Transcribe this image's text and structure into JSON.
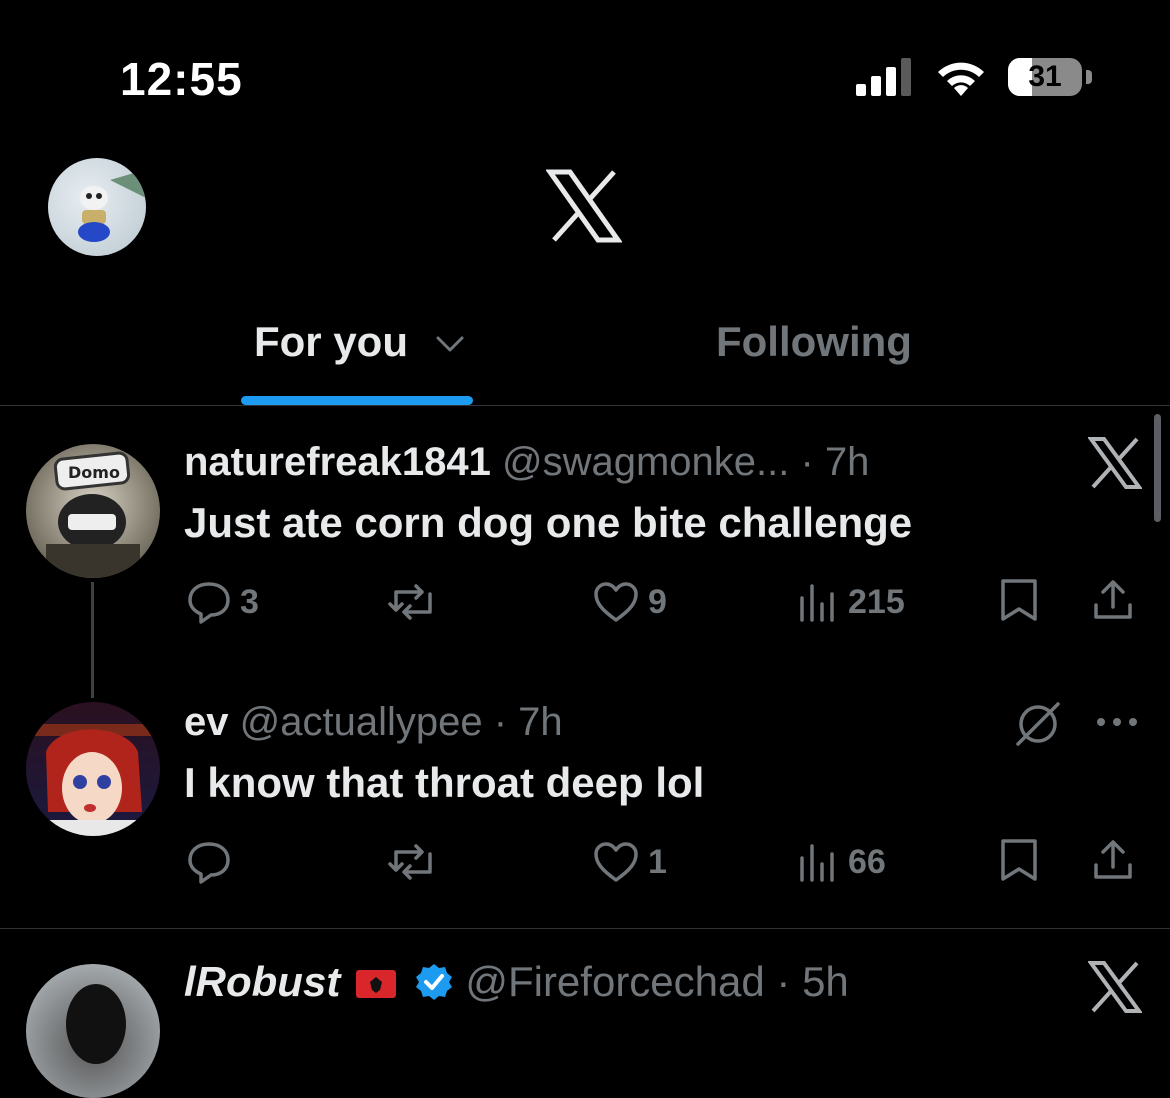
{
  "status_bar": {
    "time": "12:55",
    "battery": "31"
  },
  "header": {
    "logo_icon": "x-logo-icon"
  },
  "tabs": [
    {
      "label": "For you",
      "active": true
    },
    {
      "label": "Following",
      "active": false
    }
  ],
  "tweets": [
    {
      "name": "naturefreak1841",
      "handle": "@swagmonke...",
      "time": "· 7h",
      "text": "Just ate corn dog one bite challenge",
      "replies": "3",
      "reposts": "",
      "likes": "9",
      "views": "215",
      "avatar_text": "Domo"
    },
    {
      "name": "ev",
      "handle": "@actuallypee",
      "time": "· 7h",
      "text": "I know that throat deep lol",
      "replies": "",
      "reposts": "",
      "likes": "1",
      "views": "66"
    },
    {
      "name": "lRobust",
      "handle": "@Fireforcechad",
      "time": "· 5h",
      "verified": true
    }
  ],
  "colors": {
    "accent": "#1d9bf0",
    "muted": "#71767b",
    "text": "#e7e9ea",
    "background": "#000000"
  }
}
